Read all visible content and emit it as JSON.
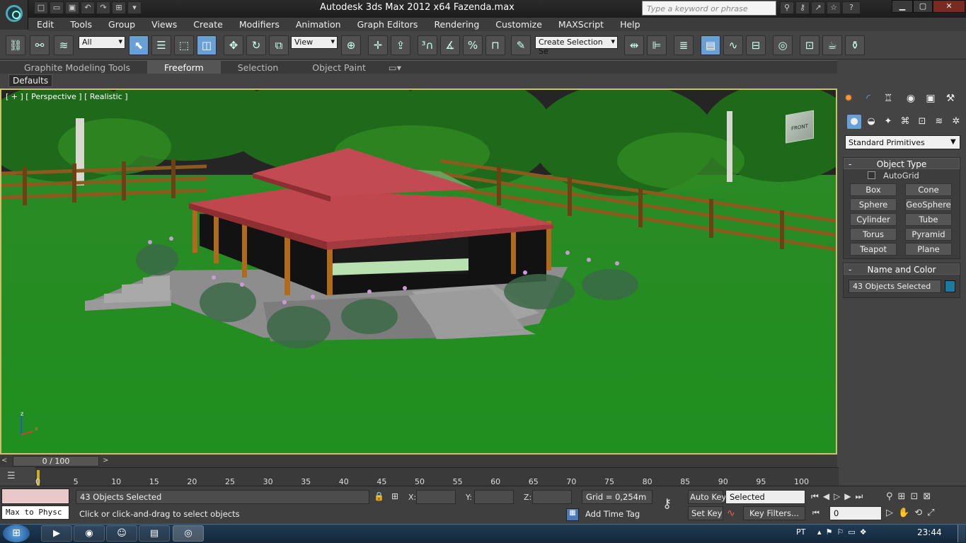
{
  "app": {
    "title": "Autodesk 3ds Max  2012 x64     Fazenda.max",
    "search_placeholder": "Type a keyword or phrase"
  },
  "menu": [
    "Edit",
    "Tools",
    "Group",
    "Views",
    "Create",
    "Modifiers",
    "Animation",
    "Graph Editors",
    "Rendering",
    "Customize",
    "MAXScript",
    "Help"
  ],
  "toolbar": {
    "selection_filter": "All",
    "reference_coord": "View",
    "named_selection": "Create Selection Se"
  },
  "ribbon": {
    "tabs": [
      "Graphite Modeling Tools",
      "Freeform",
      "Selection",
      "Object Paint"
    ],
    "active": "Freeform",
    "defaults": "Defaults"
  },
  "viewport": {
    "label": "[ + ] [ Perspective ] [ Realistic ]",
    "viewcube_label": "FRONT",
    "axis_x": "x",
    "axis_z": "z"
  },
  "command_panel": {
    "category": "Standard Primitives",
    "object_type": {
      "title": "Object Type",
      "autogrid": "AutoGrid",
      "buttons": [
        "Box",
        "Cone",
        "Sphere",
        "GeoSphere",
        "Cylinder",
        "Tube",
        "Torus",
        "Pyramid",
        "Teapot",
        "Plane"
      ]
    },
    "name_color": {
      "title": "Name and Color",
      "name_value": "43 Objects Selected",
      "color": "#1a7aa0"
    }
  },
  "timeline": {
    "slider": "0 / 100",
    "ticks": [
      "0",
      "5",
      "10",
      "15",
      "20",
      "25",
      "30",
      "35",
      "40",
      "45",
      "50",
      "55",
      "60",
      "65",
      "70",
      "75",
      "80",
      "85",
      "90",
      "95",
      "100"
    ]
  },
  "status": {
    "selected": "43 Objects Selected",
    "prompt": "Click or click-and-drag to select objects",
    "script_listener": "Max to Physc",
    "x_label": "X:",
    "y_label": "Y:",
    "z_label": "Z:",
    "grid": "Grid = 0,254m",
    "add_time_tag": "Add Time Tag",
    "auto_key": "Auto Key",
    "set_key": "Set Key",
    "key_mode": "Selected",
    "key_filters": "Key Filters...",
    "frame": "0"
  },
  "taskbar": {
    "lang": "PT",
    "time": "23:44"
  }
}
